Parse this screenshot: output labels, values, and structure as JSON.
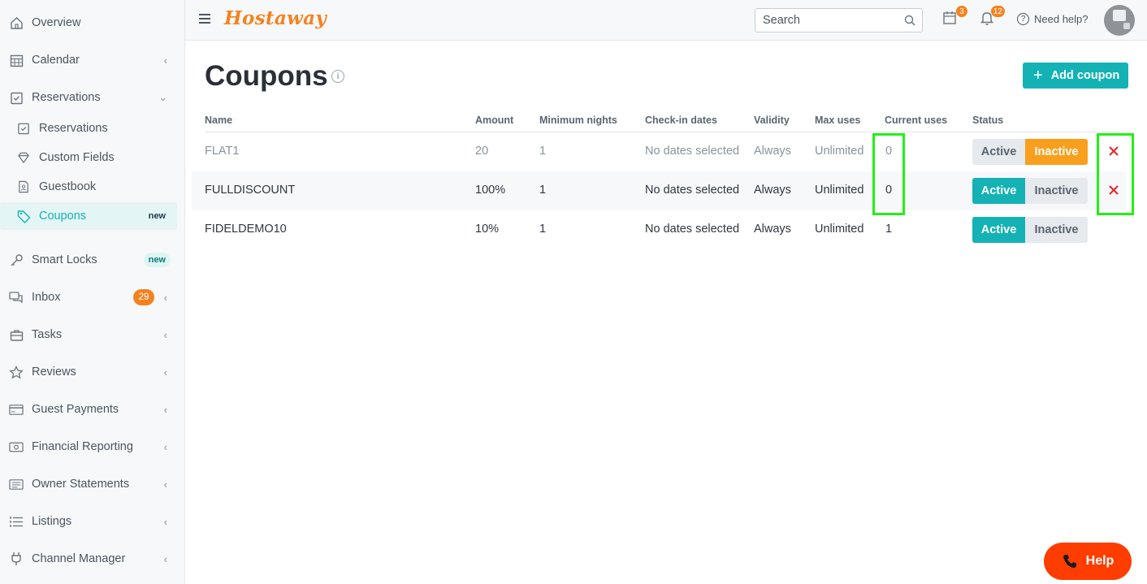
{
  "brand": {
    "logo_text": "Hostaway",
    "accent": "#14b2b4",
    "orange": "#f5821f"
  },
  "sidebar": {
    "items": [
      {
        "label": "Overview",
        "icon": "home-icon"
      },
      {
        "label": "Calendar",
        "icon": "calendar-icon"
      },
      {
        "label": "Reservations",
        "icon": "reservations-icon"
      },
      {
        "label": "Reservations",
        "icon": "reservations-icon"
      },
      {
        "label": "Custom Fields",
        "icon": "diamond-icon"
      },
      {
        "label": "Guestbook",
        "icon": "guestbook-icon"
      },
      {
        "label": "Coupons",
        "icon": "tag-icon",
        "badge": "new"
      },
      {
        "label": "Smart Locks",
        "icon": "key-icon",
        "badge": "new"
      },
      {
        "label": "Inbox",
        "icon": "chat-icon",
        "count": "29"
      },
      {
        "label": "Tasks",
        "icon": "briefcase-icon"
      },
      {
        "label": "Reviews",
        "icon": "star-icon"
      },
      {
        "label": "Guest Payments",
        "icon": "card-icon"
      },
      {
        "label": "Financial Reporting",
        "icon": "money-icon"
      },
      {
        "label": "Owner Statements",
        "icon": "statement-icon"
      },
      {
        "label": "Listings",
        "icon": "list-icon"
      },
      {
        "label": "Channel Manager",
        "icon": "plug-icon"
      }
    ]
  },
  "topbar": {
    "search_placeholder": "Search",
    "calendar_badge": "3",
    "notifications_badge": "12",
    "help_label": "Need help?"
  },
  "page": {
    "title": "Coupons",
    "add_button": "Add coupon"
  },
  "table": {
    "headers": [
      "Name",
      "Amount",
      "Minimum nights",
      "Check-in dates",
      "Validity",
      "Max uses",
      "Current uses",
      "Status"
    ],
    "rows": [
      {
        "name": "FLAT1",
        "amount": "20",
        "min_nights": "1",
        "checkin": "No dates selected",
        "validity": "Always",
        "max_uses": "Unlimited",
        "current_uses": "0",
        "status": "Inactive"
      },
      {
        "name": "FULLDISCOUNT",
        "amount": "100%",
        "min_nights": "1",
        "checkin": "No dates selected",
        "validity": "Always",
        "max_uses": "Unlimited",
        "current_uses": "0",
        "status": "Active"
      },
      {
        "name": "FIDELDEMO10",
        "amount": "10%",
        "min_nights": "1",
        "checkin": "No dates selected",
        "validity": "Always",
        "max_uses": "Unlimited",
        "current_uses": "1",
        "status": "Active"
      }
    ],
    "status_active_label": "Active",
    "status_inactive_label": "Inactive"
  },
  "help_fab_label": "Help"
}
